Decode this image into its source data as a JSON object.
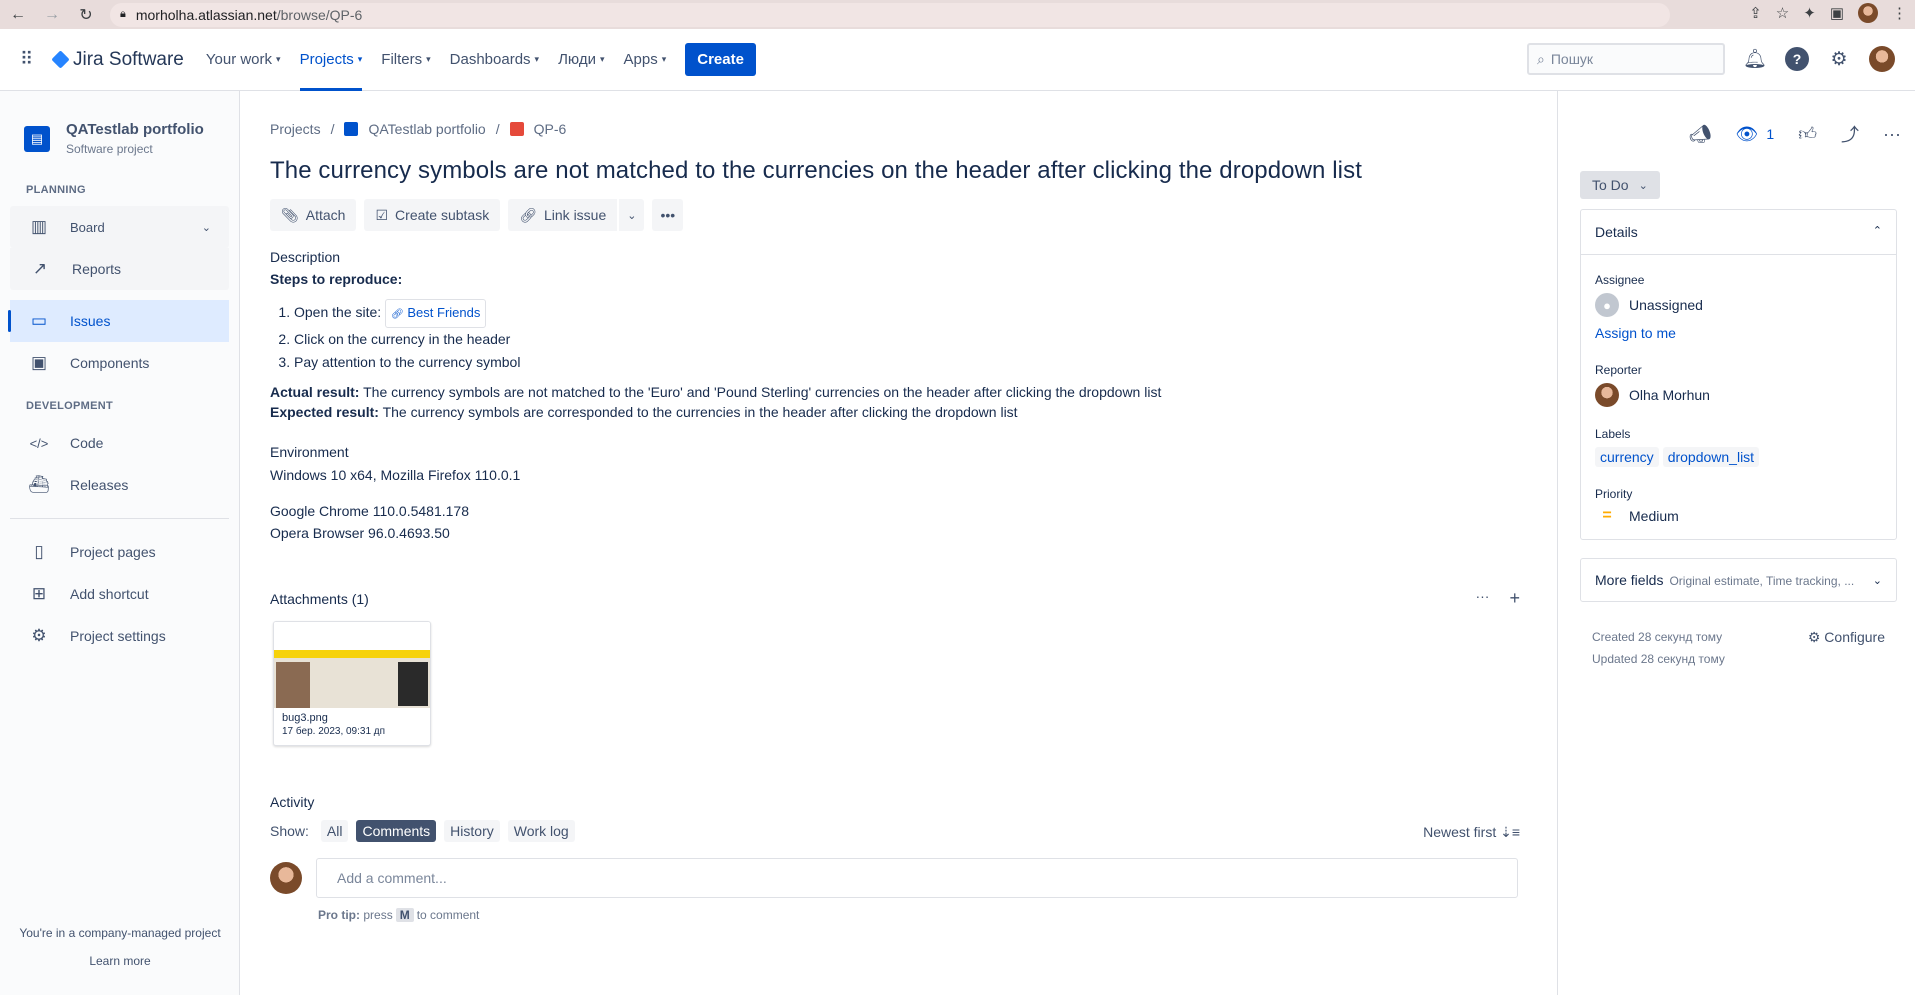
{
  "browser": {
    "url_host": "morholha.atlassian.net",
    "url_path": "/browse/QP-6"
  },
  "topnav": {
    "product": "Jira Software",
    "items": [
      {
        "label": "Your work"
      },
      {
        "label": "Projects"
      },
      {
        "label": "Filters"
      },
      {
        "label": "Dashboards"
      },
      {
        "label": "Люди"
      },
      {
        "label": "Apps"
      }
    ],
    "create_label": "Create",
    "search_placeholder": "Пошук"
  },
  "sidebar": {
    "project_name": "QATestlab portfolio",
    "project_type": "Software project",
    "planning_label": "PLANNING",
    "board_label": "Board",
    "reports_label": "Reports",
    "issues_label": "Issues",
    "components_label": "Components",
    "development_label": "DEVELOPMENT",
    "code_label": "Code",
    "releases_label": "Releases",
    "project_pages_label": "Project pages",
    "add_shortcut_label": "Add shortcut",
    "project_settings_label": "Project settings",
    "footer_text": "You're in a company-managed project",
    "learn_more": "Learn more"
  },
  "breadcrumb": {
    "projects": "Projects",
    "project": "QATestlab portfolio",
    "issue_key": "QP-6"
  },
  "issue": {
    "title": "The currency symbols are not matched to the currencies on the header after clicking the dropdown list",
    "actions": {
      "attach": "Attach",
      "create_subtask": "Create subtask",
      "link_issue": "Link issue"
    },
    "description_title": "Description",
    "steps_title": "Steps to reproduce:",
    "step1_prefix": "Open the site:",
    "step1_link": "Best Friends",
    "step2": "Click on the currency in the header",
    "step3": "Pay attention to the currency symbol",
    "actual_label": "Actual result:",
    "actual_text": "The currency symbols are not matched to the 'Euro' and 'Pound Sterling' currencies on the header after clicking the dropdown list",
    "expected_label": "Expected result:",
    "expected_text": "The currency symbols are corresponded to the currencies in the header after clicking the dropdown list",
    "environment_title": "Environment",
    "env1": "Windows 10 x64, Mozilla Firefox 110.0.1",
    "env2": "Google Chrome 110.0.5481.178",
    "env3": "Opera Browser 96.0.4693.50",
    "attachments_title": "Attachments (1)",
    "attachment_name": "bug3.png",
    "attachment_date": "17 бер. 2023, 09:31 дп"
  },
  "activity": {
    "title": "Activity",
    "show_label": "Show:",
    "filters": [
      "All",
      "Comments",
      "History",
      "Work log"
    ],
    "sort_label": "Newest first",
    "comment_placeholder": "Add a comment...",
    "protip_prefix": "Pro tip:",
    "protip_press": "press",
    "protip_key": "M",
    "protip_suffix": "to comment"
  },
  "right": {
    "watch_count": "1",
    "status": "To Do",
    "details_title": "Details",
    "assignee_label": "Assignee",
    "assignee_value": "Unassigned",
    "assign_to_me": "Assign to me",
    "reporter_label": "Reporter",
    "reporter_value": "Olha Morhun",
    "labels_label": "Labels",
    "labels": [
      "currency",
      "dropdown_list"
    ],
    "priority_label": "Priority",
    "priority_value": "Medium",
    "more_fields": "More fields",
    "more_fields_sub": "Original estimate, Time tracking, ...",
    "created": "Created 28 секунд тому",
    "updated": "Updated 28 секунд тому",
    "configure": "Configure"
  },
  "colors": {
    "accent": "#0052cc",
    "priority_medium": "#ffab00",
    "sidebar_active_bg": "#deebff"
  }
}
